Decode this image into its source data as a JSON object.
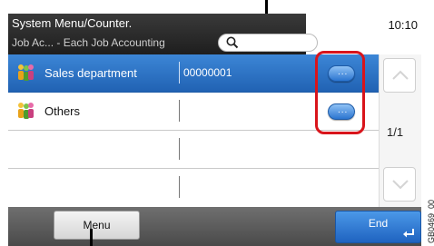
{
  "header": {
    "title": "System Menu/Counter.",
    "subtitle": "Job Ac... - Each Job Accounting",
    "clock": "10:10",
    "search_icon": "magnifier"
  },
  "accounts": [
    {
      "name": "Sales department",
      "number": "00000001",
      "selected": true,
      "icon": "group-icon",
      "detail_label": "..."
    },
    {
      "name": "Others",
      "number": "",
      "selected": false,
      "icon": "group-icon",
      "detail_label": "..."
    },
    {
      "name": "",
      "number": "",
      "selected": false
    },
    {
      "name": "",
      "number": "",
      "selected": false
    }
  ],
  "scroll": {
    "page": "1/1"
  },
  "footer": {
    "menu_label": "Menu",
    "end_label": "End"
  },
  "figure_code": "GB0469_00",
  "colors": {
    "accent": "#2b75d0",
    "highlight": "#d9141b"
  }
}
